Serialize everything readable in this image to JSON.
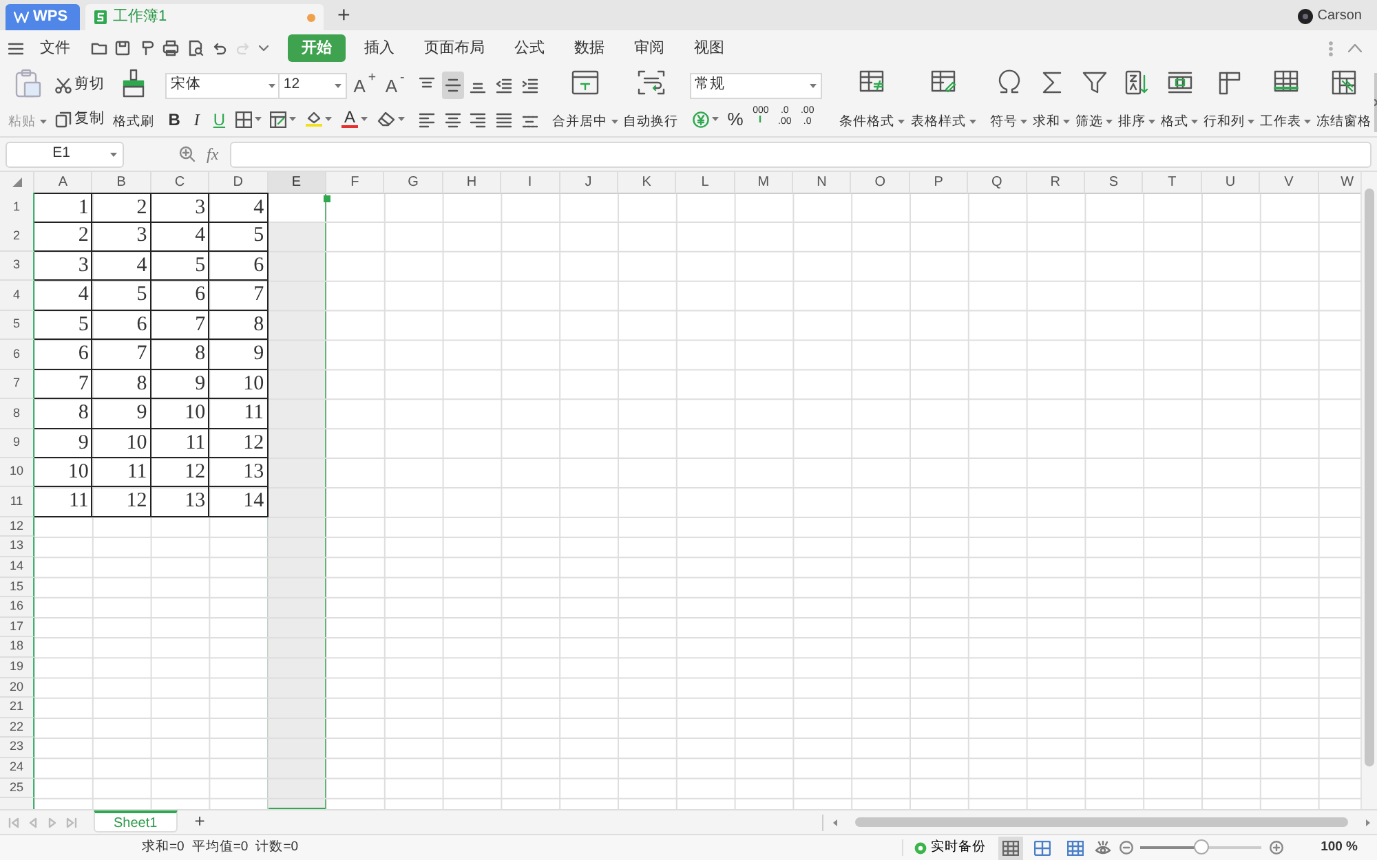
{
  "tab_bar": {
    "app_tab": "WPS",
    "doc_tab": {
      "title": "工作簿1",
      "unsaved": true
    },
    "new_tab": "+",
    "user": "Carson"
  },
  "menu": {
    "file": "文件",
    "quick_access": [
      {
        "disabled": false
      },
      {
        "disabled": false
      },
      {
        "disabled": false
      },
      {
        "disabled": false
      },
      {
        "disabled": false
      },
      {
        "disabled": false
      },
      {
        "disabled": true
      }
    ],
    "ribbon_tabs": [
      {
        "label": "开始",
        "selected": true
      },
      {
        "label": "插入",
        "selected": false
      },
      {
        "label": "页面布局",
        "selected": false
      },
      {
        "label": "公式",
        "selected": false
      },
      {
        "label": "数据",
        "selected": false
      },
      {
        "label": "审阅",
        "selected": false
      },
      {
        "label": "视图",
        "selected": false
      }
    ]
  },
  "ribbon": {
    "paste": {
      "label": "粘贴",
      "disabled": true,
      "dropdown": true
    },
    "cut": "剪切",
    "copy": "复制",
    "format_painter": "格式刷",
    "font_name": "宋体",
    "font_size": "12",
    "grow_font": "A$^{+}$",
    "shrink_font": "A$^{-}$",
    "style_buttons": [
      {
        "label": "B",
        "kind": "bold"
      },
      {
        "label": "I",
        "kind": "italic"
      },
      {
        "label": "U",
        "kind": "underline"
      }
    ],
    "color_buttons": [
      {
        "kind": "fill",
        "color": "#f2e01a"
      },
      {
        "kind": "font",
        "label": "A",
        "color": "#e53030"
      }
    ],
    "vertical_align": [
      {
        "selected": false
      },
      {
        "selected": true
      },
      {
        "selected": false
      }
    ],
    "merge": {
      "label": "合并居中",
      "dropdown": true
    },
    "wrap": "自动换行",
    "number_format": "常规",
    "percent": "%",
    "thousands": "000",
    "increase_decimal": [
      ".0",
      ".00"
    ],
    "decrease_decimal": [
      ".00",
      ".0"
    ],
    "style_tools": [
      {
        "label": "条件格式",
        "dropdown": true
      },
      {
        "label": "表格样式",
        "dropdown": true
      }
    ],
    "tools": [
      {
        "label": "符号",
        "dropdown": true
      },
      {
        "label": "求和",
        "dropdown": true
      },
      {
        "label": "筛选",
        "dropdown": true
      },
      {
        "label": "排序",
        "dropdown": true
      },
      {
        "label": "格式",
        "dropdown": true
      },
      {
        "label": "行和列",
        "dropdown": true
      },
      {
        "label": "工作表",
        "dropdown": true
      },
      {
        "label": "冻结窗格",
        "dropdown": false
      }
    ]
  },
  "formula_bar": {
    "name_box": "E1",
    "fx": "fx"
  },
  "sheet": {
    "columns": [
      {
        "label": "A",
        "selected": false
      },
      {
        "label": "B",
        "selected": false
      },
      {
        "label": "C",
        "selected": false
      },
      {
        "label": "D",
        "selected": false
      },
      {
        "label": "E",
        "selected": true
      },
      {
        "label": "F",
        "selected": false
      },
      {
        "label": "G",
        "selected": false
      },
      {
        "label": "H",
        "selected": false
      },
      {
        "label": "I",
        "selected": false
      },
      {
        "label": "J",
        "selected": false
      },
      {
        "label": "K",
        "selected": false
      },
      {
        "label": "L",
        "selected": false
      },
      {
        "label": "M",
        "selected": false
      },
      {
        "label": "N",
        "selected": false
      },
      {
        "label": "O",
        "selected": false
      },
      {
        "label": "P",
        "selected": false
      },
      {
        "label": "Q",
        "selected": false
      },
      {
        "label": "R",
        "selected": false
      },
      {
        "label": "S",
        "selected": false
      },
      {
        "label": "T",
        "selected": false
      },
      {
        "label": "U",
        "selected": false
      },
      {
        "label": "V",
        "selected": false
      },
      {
        "label": "W",
        "selected": false
      }
    ],
    "rows": [
      {
        "header": "1",
        "cells": [
          "1",
          "2",
          "3",
          "4"
        ]
      },
      {
        "header": "2",
        "cells": [
          "2",
          "3",
          "4",
          "5"
        ]
      },
      {
        "header": "3",
        "cells": [
          "3",
          "4",
          "5",
          "6"
        ]
      },
      {
        "header": "4",
        "cells": [
          "4",
          "5",
          "6",
          "7"
        ]
      },
      {
        "header": "5",
        "cells": [
          "5",
          "6",
          "7",
          "8"
        ]
      },
      {
        "header": "6",
        "cells": [
          "6",
          "7",
          "8",
          "9"
        ]
      },
      {
        "header": "7",
        "cells": [
          "7",
          "8",
          "9",
          "10"
        ]
      },
      {
        "header": "8",
        "cells": [
          "8",
          "9",
          "10",
          "11"
        ]
      },
      {
        "header": "9",
        "cells": [
          "9",
          "10",
          "11",
          "12"
        ]
      },
      {
        "header": "10",
        "cells": [
          "10",
          "11",
          "12",
          "13"
        ]
      },
      {
        "header": "11",
        "cells": [
          "11",
          "12",
          "13",
          "14"
        ]
      },
      {
        "header": "12"
      },
      {
        "header": "13"
      },
      {
        "header": "14"
      },
      {
        "header": "15"
      },
      {
        "header": "16"
      },
      {
        "header": "17"
      },
      {
        "header": "18"
      },
      {
        "header": "19"
      },
      {
        "header": "20"
      },
      {
        "header": "21"
      },
      {
        "header": "22"
      },
      {
        "header": "23"
      },
      {
        "header": "24"
      },
      {
        "header": "25"
      }
    ],
    "sheet_tabs": [
      {
        "label": "Sheet1",
        "selected": true
      }
    ],
    "add_sheet": "+"
  },
  "status_bar": {
    "stats": [
      "求和=0",
      "平均值=0",
      "计数=0"
    ],
    "backup": "实时备份",
    "views": [
      {
        "selected": true
      },
      {
        "selected": false
      },
      {
        "selected": false
      }
    ],
    "zoom": {
      "level": 0.5,
      "reading": "100 %"
    }
  }
}
